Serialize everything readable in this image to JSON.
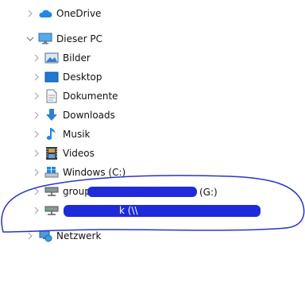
{
  "nav": {
    "onedrive": {
      "label": "OneDrive",
      "icon": "cloud-icon"
    },
    "this_pc": {
      "label": "Dieser PC",
      "icon": "monitor-icon"
    },
    "children": [
      {
        "id": "bilder",
        "label": "Bilder",
        "icon": "pictures-icon"
      },
      {
        "id": "desktop",
        "label": "Desktop",
        "icon": "desktop-icon"
      },
      {
        "id": "dokumente",
        "label": "Dokumente",
        "icon": "document-icon"
      },
      {
        "id": "downloads",
        "label": "Downloads",
        "icon": "download-arrow-icon"
      },
      {
        "id": "musik",
        "label": "Musik",
        "icon": "music-note-icon"
      },
      {
        "id": "videos",
        "label": "Videos",
        "icon": "film-icon"
      },
      {
        "id": "windows",
        "label": "Windows (C:)",
        "icon": "windows-drive-icon"
      }
    ],
    "network_drives": [
      {
        "id": "drive-g",
        "label_start": "group",
        "label_end": "(G:)",
        "icon": "network-drive-icon"
      },
      {
        "id": "drive-2",
        "label_fragment": "k (\\\\",
        "icon": "network-drive-icon"
      }
    ],
    "network": {
      "label": "Netzwerk",
      "icon": "network-icon"
    }
  },
  "colors": {
    "onedrive_blue": "#1e88e5",
    "annotation_blue": "#1f2adb",
    "chevron": "#a8a8a8"
  }
}
